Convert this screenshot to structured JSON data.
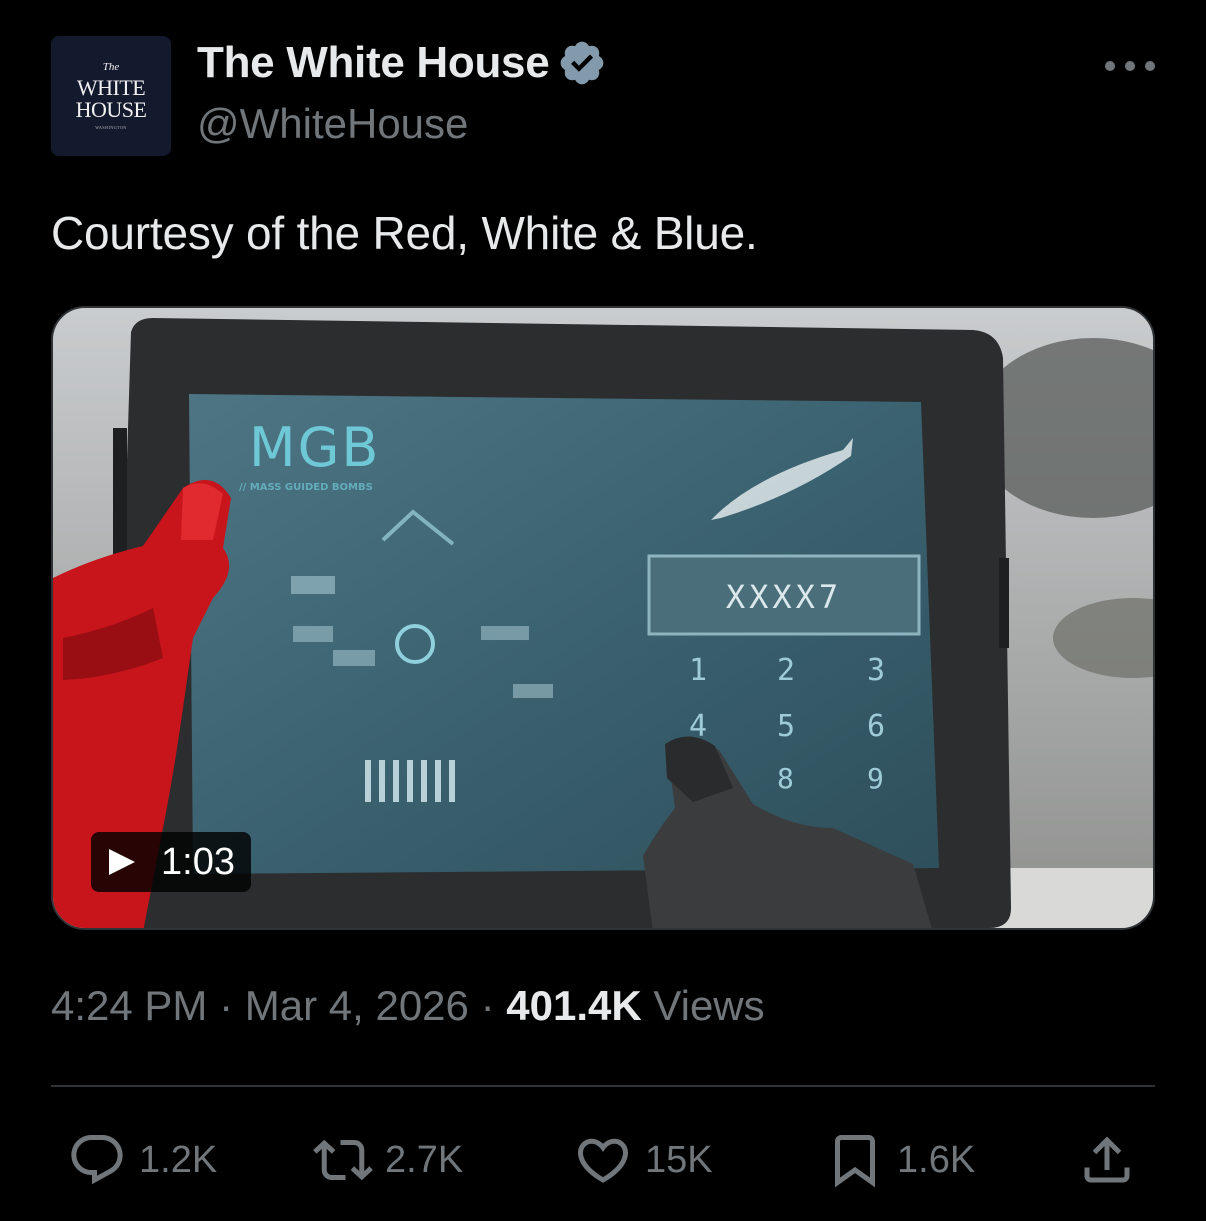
{
  "account": {
    "avatar": {
      "line_small": "The",
      "line1": "WHITE",
      "line2": "HOUSE",
      "line_tiny": "WASHINGTON"
    },
    "display_name": "The White House",
    "handle": "@WhiteHouse",
    "verified_color": "#829aab"
  },
  "tweet": {
    "text": "Courtesy of the Red, White & Blue."
  },
  "media": {
    "duration": "1:03",
    "screen_title": "MGB",
    "screen_subtitle": "// MASS GUIDED BOMBS",
    "code_display": "XXXX7",
    "keypad": [
      "1",
      "2",
      "3",
      "4",
      "5",
      "6",
      "8",
      "9"
    ]
  },
  "meta": {
    "time": "4:24 PM",
    "separator": "·",
    "date": "Mar 4, 2026",
    "views_count": "401.4K",
    "views_label": "Views"
  },
  "actions": {
    "replies": "1.2K",
    "reposts": "2.7K",
    "likes": "15K",
    "bookmarks": "1.6K"
  },
  "colors": {
    "background": "#000000",
    "primary_text": "#e7e9ea",
    "secondary_text": "#71767b",
    "divider": "#2f3336",
    "screen_text": "#6fc8d6"
  }
}
